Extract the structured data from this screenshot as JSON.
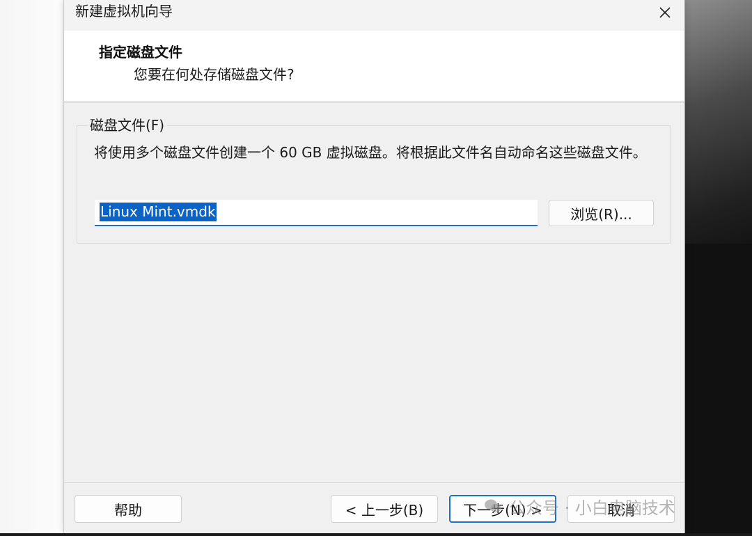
{
  "window": {
    "title": "新建虚拟机向导"
  },
  "header": {
    "title": "指定磁盘文件",
    "subtitle": "您要在何处存储磁盘文件?"
  },
  "disk_file_group": {
    "label": "磁盘文件(F)",
    "description": "将使用多个磁盘文件创建一个 60 GB 虚拟磁盘。将根据此文件名自动命名这些磁盘文件。",
    "filename_value": "Linux Mint.vmdk",
    "browse_label": "浏览(R)..."
  },
  "footer": {
    "help_label": "帮助",
    "back_label": "< 上一步(B)",
    "next_label": "下一步(N) >",
    "cancel_label": "取消"
  },
  "watermark": {
    "text": "公众号 · 小白电脑技术"
  },
  "colors": {
    "accent": "#1f6fc5",
    "selection": "#0a64c8",
    "dialog_bg": "#f0f0f0",
    "header_bg": "#ffffff"
  },
  "icons": {
    "close": "close-icon",
    "watermark": "wechat-icon"
  }
}
